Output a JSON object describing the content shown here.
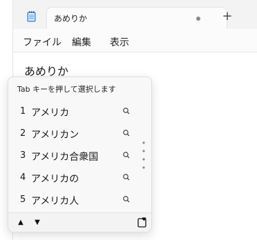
{
  "tab": {
    "title": "あめりか"
  },
  "new_tab_glyph": "+",
  "menu": {
    "file": "ファイル",
    "edit": "編集",
    "view": "表示"
  },
  "editor": {
    "text": "あめりか"
  },
  "ime": {
    "hint": "Tab キーを押して選択します",
    "candidates": [
      {
        "num": "1",
        "text": "アメリカ"
      },
      {
        "num": "2",
        "text": "アメリカン"
      },
      {
        "num": "3",
        "text": "アメリカ合衆国"
      },
      {
        "num": "4",
        "text": "アメリカの"
      },
      {
        "num": "5",
        "text": "アメリカ人"
      }
    ],
    "prev_glyph": "▲",
    "next_glyph": "▼"
  },
  "colors": {
    "notepad_icon": "#3a8be0",
    "text": "#1a1a1a"
  }
}
